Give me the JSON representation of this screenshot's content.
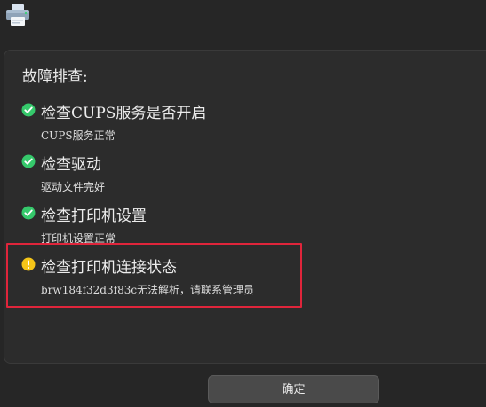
{
  "app": {
    "icon": "printer-icon"
  },
  "troubleshoot": {
    "heading": "故障排查:",
    "items": [
      {
        "title": "检查CUPS服务是否开启",
        "detail": "CUPS服务正常",
        "status": "success",
        "icon": "check-circle-icon"
      },
      {
        "title": "检查驱动",
        "detail": "驱动文件完好",
        "status": "success",
        "icon": "check-circle-icon"
      },
      {
        "title": "检查打印机设置",
        "detail": "打印机设置正常",
        "status": "success",
        "icon": "check-circle-icon"
      },
      {
        "title": "检查打印机连接状态",
        "detail": "brw184f32d3f83c无法解析，请联系管理员",
        "status": "warning",
        "icon": "warning-circle-icon"
      }
    ]
  },
  "footer": {
    "confirm_label": "确定"
  },
  "colors": {
    "success": "#35c96b",
    "warning": "#f5c518",
    "highlight": "#e0253b"
  }
}
